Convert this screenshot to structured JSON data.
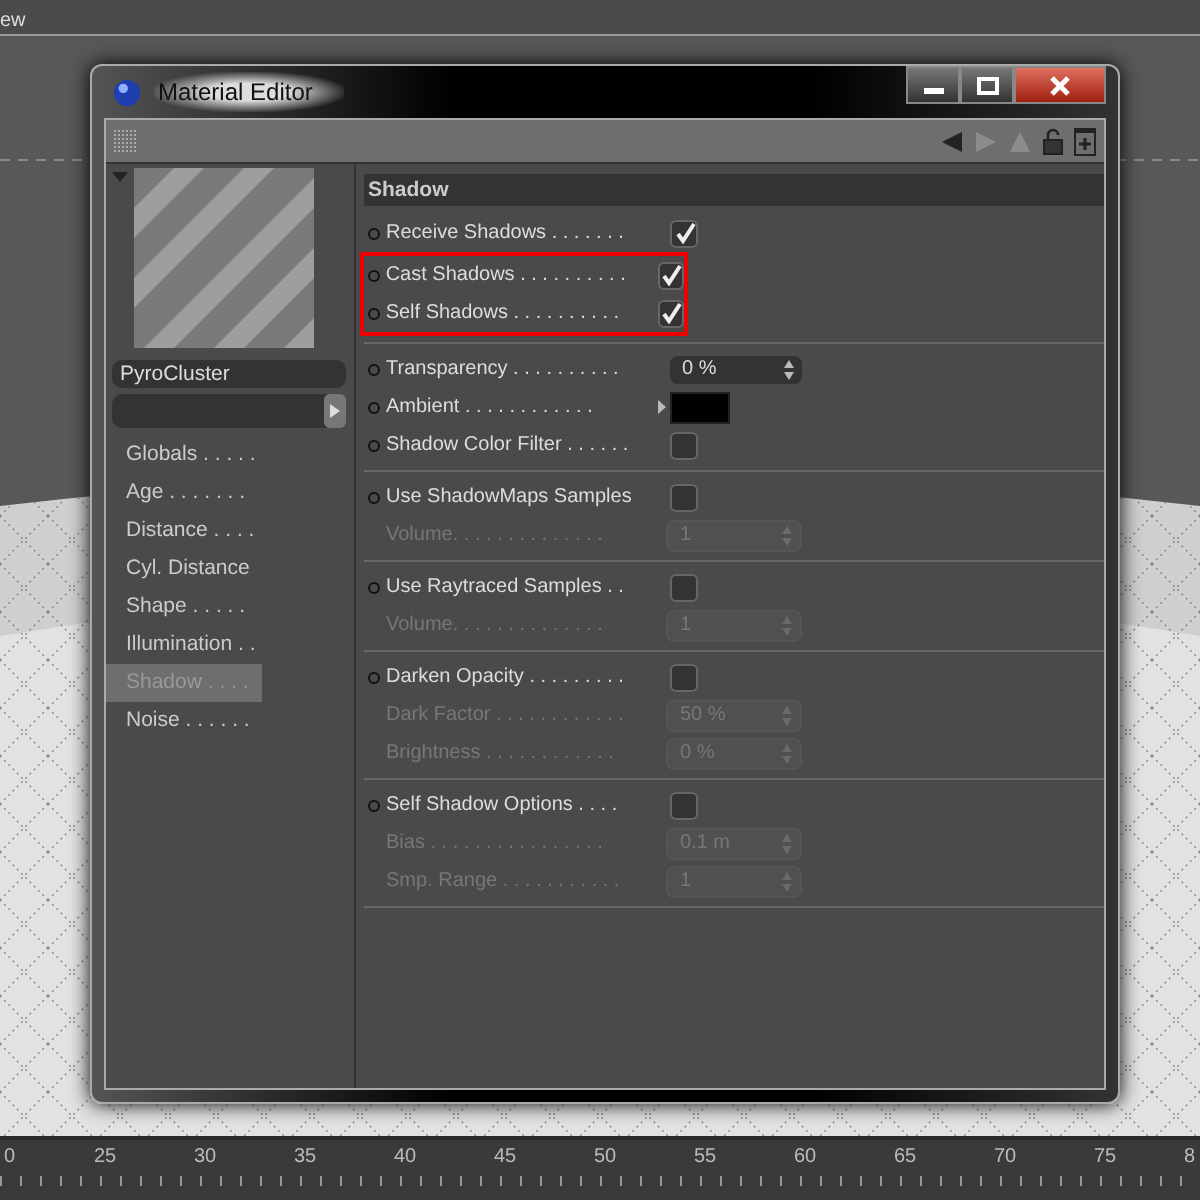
{
  "viewport": {
    "menu_text": "ew"
  },
  "window": {
    "title": "Material Editor"
  },
  "material": {
    "name": "PyroCluster"
  },
  "channels": [
    {
      "label": "Globals . . . . .",
      "selected": false
    },
    {
      "label": "Age . . . . . . .",
      "selected": false
    },
    {
      "label": "Distance . . . .",
      "selected": false
    },
    {
      "label": "Cyl. Distance",
      "selected": false
    },
    {
      "label": "Shape . . . . .",
      "selected": false
    },
    {
      "label": "Illumination . .",
      "selected": false
    },
    {
      "label": "Shadow . . . .",
      "selected": true
    },
    {
      "label": "Noise . . . . . .",
      "selected": false
    }
  ],
  "section": {
    "title": "Shadow"
  },
  "groups": [
    {
      "rows": [
        {
          "kind": "checkbox",
          "label": "Receive Shadows . . . . . . .",
          "checked": true,
          "disabled": false,
          "highlighted": false
        },
        {
          "kind": "checkbox",
          "label": "Cast Shadows . . . . . . . . . .",
          "checked": true,
          "disabled": false,
          "highlighted": true
        },
        {
          "kind": "checkbox",
          "label": "Self Shadows . . . . . . . . . .",
          "checked": true,
          "disabled": false,
          "highlighted": true
        }
      ]
    },
    {
      "rows": [
        {
          "kind": "number",
          "label": "Transparency . . . . . . . . . .",
          "value": "0 %",
          "disabled": false,
          "highlighted": false
        },
        {
          "kind": "color",
          "label": "Ambient . . . . . . . . . . . .",
          "color": "#000000",
          "disabled": false,
          "highlighted": false
        },
        {
          "kind": "checkbox",
          "label": "Shadow Color Filter . . . . . .",
          "checked": false,
          "disabled": false,
          "highlighted": false
        }
      ]
    },
    {
      "rows": [
        {
          "kind": "checkbox",
          "label": "Use ShadowMaps Samples",
          "checked": false,
          "disabled": false,
          "highlighted": false
        },
        {
          "kind": "number",
          "label": "Volume. . . . . . . . . . . . . .",
          "value": "1",
          "disabled": true,
          "highlighted": false
        }
      ]
    },
    {
      "rows": [
        {
          "kind": "checkbox",
          "label": "Use Raytraced Samples . .",
          "checked": false,
          "disabled": false,
          "highlighted": false
        },
        {
          "kind": "number",
          "label": "Volume. . . . . . . . . . . . . .",
          "value": "1",
          "disabled": true,
          "highlighted": false
        }
      ]
    },
    {
      "rows": [
        {
          "kind": "checkbox",
          "label": "Darken Opacity . . . . . . . . .",
          "checked": false,
          "disabled": false,
          "highlighted": false
        },
        {
          "kind": "number",
          "label": "Dark Factor . . . . . . . . . . . .",
          "value": "50 %",
          "disabled": true,
          "highlighted": false
        },
        {
          "kind": "number",
          "label": "Brightness . . . . . . . . . . . .",
          "value": "0 %",
          "disabled": true,
          "highlighted": false
        }
      ]
    },
    {
      "rows": [
        {
          "kind": "checkbox",
          "label": "Self Shadow Options . . . .",
          "checked": false,
          "disabled": false,
          "highlighted": false
        },
        {
          "kind": "number",
          "label": "Bias . . . . . . . . . . . . . . . .",
          "value": "0.1 m",
          "disabled": true,
          "highlighted": false
        },
        {
          "kind": "number",
          "label": "Smp. Range . . . . . . . . . . .",
          "value": "1",
          "disabled": true,
          "highlighted": false
        }
      ]
    }
  ],
  "ruler": {
    "labels": [
      "0",
      "25",
      "30",
      "35",
      "40",
      "45",
      "50",
      "55",
      "60",
      "65",
      "70",
      "75",
      "8"
    ]
  }
}
